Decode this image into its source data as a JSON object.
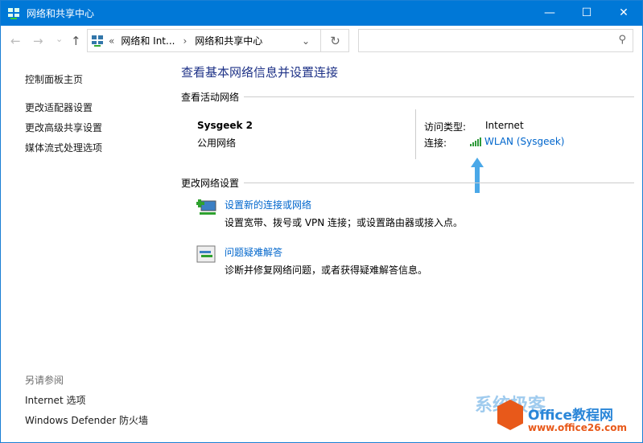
{
  "window": {
    "title": "网络和共享中心",
    "minimize": "—",
    "maximize": "☐",
    "close": "✕"
  },
  "nav": {
    "back": "←",
    "forward": "→",
    "recent": "⌄",
    "up": "↑",
    "breadcrumb_overflow": "«",
    "crumb1": "网络和 Int...",
    "sep": "›",
    "crumb2": "网络和共享中心",
    "dropdown": "⌄",
    "refresh": "↻",
    "search_placeholder": "",
    "search_icon": "⚲"
  },
  "sidebar": {
    "home": "控制面板主页",
    "items": [
      "更改适配器设置",
      "更改高级共享设置",
      "媒体流式处理选项"
    ],
    "see_also_title": "另请参阅",
    "see_also": [
      "Internet 选项",
      "Windows Defender 防火墙"
    ]
  },
  "main": {
    "heading": "查看基本网络信息并设置连接",
    "active_title": "查看活动网络",
    "network_name": "Sysgeek 2",
    "network_type": "公用网络",
    "access_label": "访问类型:",
    "access_value": "Internet",
    "conn_label": "连接:",
    "conn_value": "WLAN (Sysgeek)",
    "change_title": "更改网络设置",
    "tasks": [
      {
        "title": "设置新的连接或网络",
        "desc": "设置宽带、拨号或 VPN 连接；或设置路由器或接入点。"
      },
      {
        "title": "问题疑难解答",
        "desc": "诊断并修复网络问题，或者获得疑难解答信息。"
      }
    ]
  },
  "watermark": {
    "brand1": "系统极客",
    "brand2": "Office教程网",
    "url": "www.office26.com"
  },
  "colors": {
    "titlebar": "#0078d7",
    "link": "#0066cc",
    "heading": "#1e3287",
    "arrow": "#4aa8e8"
  }
}
